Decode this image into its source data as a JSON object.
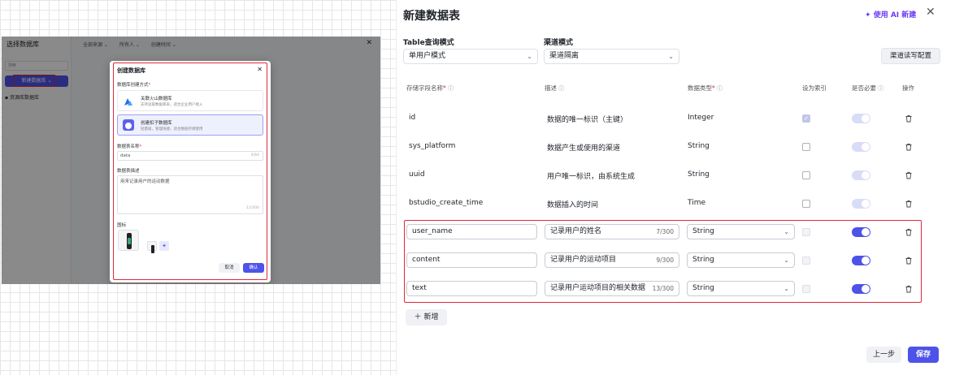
{
  "left_screenshot": {
    "sidebar_title": "选择数据库",
    "search_placeholder": "搜索",
    "new_db_button": "新建数据库",
    "resource_item": "资源库数据库",
    "filters": [
      "全部来源",
      "所有人",
      "创建时间"
    ],
    "dialog": {
      "title": "创建数据库",
      "method_label": "数据库创建方式",
      "method_required": "*",
      "options": [
        {
          "title": "关联火山数据库",
          "desc": "支持读取数据库表，适合企业用户接入"
        },
        {
          "title": "创建扣子数据库",
          "desc": "轻量级，管理快捷，适合数据存储使用"
        }
      ],
      "name_label": "数据表名称",
      "name_required": "*",
      "name_value": "data",
      "name_count": "4/64",
      "desc_label": "数据表描述",
      "desc_value": "用来记录用户的运动数据",
      "desc_count": "11/500",
      "icon_label": "图标",
      "cancel": "取消",
      "confirm": "确认"
    }
  },
  "panel": {
    "title": "新建数据表",
    "ai_button": "使用 AI 新建",
    "query_mode_label": "Table查询模式",
    "query_mode_value": "单用户模式",
    "channel_label": "渠道模式",
    "channel_value": "渠道隔离",
    "channel_config_button": "渠道读写配置",
    "columns": {
      "field_name": "存储字段名称",
      "description": "描述",
      "data_type": "数据类型",
      "index": "设为索引",
      "required": "是否必要",
      "actions": "操作"
    },
    "system_rows": [
      {
        "name": "id",
        "desc": "数据的唯一标识（主键）",
        "type": "Integer"
      },
      {
        "name": "sys_platform",
        "desc": "数据产生或使用的渠道",
        "type": "String"
      },
      {
        "name": "uuid",
        "desc": "用户唯一标识，由系统生成",
        "type": "String"
      },
      {
        "name": "bstudio_create_time",
        "desc": "数据插入的时间",
        "type": "Time"
      }
    ],
    "user_rows": [
      {
        "name": "user_name",
        "desc": "记录用户的姓名",
        "count": "7/300",
        "type": "String"
      },
      {
        "name": "content",
        "desc": "记录用户的运动项目",
        "count": "9/300",
        "type": "String"
      },
      {
        "name": "text",
        "desc": "记录用户运动项目的相关数据",
        "count": "13/300",
        "type": "String"
      }
    ],
    "add_button": "新增",
    "prev_button": "上一步",
    "save_button": "保存"
  }
}
